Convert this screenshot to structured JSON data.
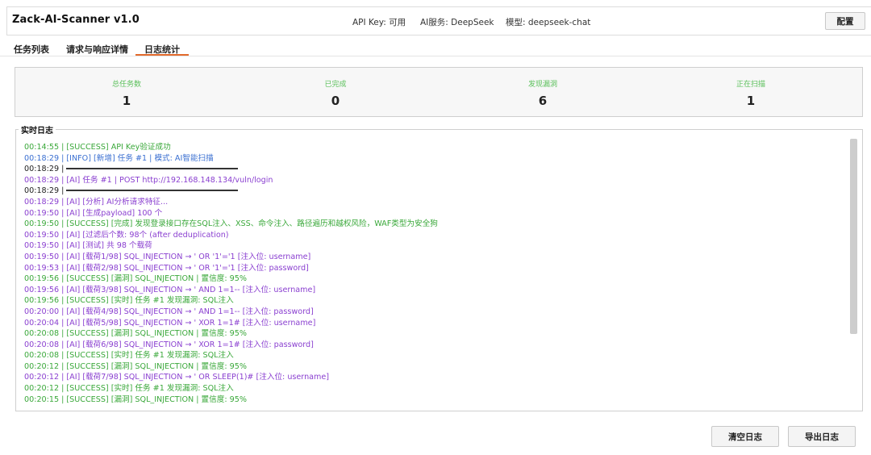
{
  "header": {
    "title": "Zack-AI-Scanner v1.0",
    "api_key_status": "API Key: 可用",
    "ai_service": "AI服务: DeepSeek",
    "model": "模型: deepseek-chat",
    "config_label": "配置"
  },
  "tabs": [
    {
      "label": "任务列表",
      "active": false
    },
    {
      "label": "请求与响应详情",
      "active": false
    },
    {
      "label": "日志统计",
      "active": true
    }
  ],
  "colors": {
    "accent": "#e26a2c",
    "success": "#3aa83a",
    "info": "#3a6fd1",
    "ai": "#8a3fd0"
  },
  "stats": [
    {
      "label": "总任务数",
      "value": "1"
    },
    {
      "label": "已完成",
      "value": "0"
    },
    {
      "label": "发现漏洞",
      "value": "6"
    },
    {
      "label": "正在扫描",
      "value": "1"
    }
  ],
  "log": {
    "title": "实时日志",
    "lines": [
      {
        "text": "00:14:55 | [SUCCESS] API Key验证成功",
        "level": "success"
      },
      {
        "text": "00:18:29 | [INFO] [新增] 任务 #1 | 模式: AI智能扫描",
        "level": "info"
      },
      {
        "text": "00:18:29 | ",
        "level": "separator"
      },
      {
        "text": "00:18:29 | [AI] 任务 #1 | POST http://192.168.148.134/vuln/login",
        "level": "ai"
      },
      {
        "text": "00:18:29 | ",
        "level": "separator"
      },
      {
        "text": "00:18:29 | [AI] [分析] AI分析请求特征...",
        "level": "ai"
      },
      {
        "text": "00:19:50 | [AI] [生成payload] 100 个",
        "level": "ai"
      },
      {
        "text": "00:19:50 | [SUCCESS] [完成] 发现登录接口存在SQL注入、XSS、命令注入、路径遍历和越权风险，WAF类型为安全狗",
        "level": "success"
      },
      {
        "text": "00:19:50 | [AI] [过滤后个数: 98个 (after deduplication)",
        "level": "ai"
      },
      {
        "text": "00:19:50 | [AI] [测试] 共 98 个载荷",
        "level": "ai"
      },
      {
        "text": "00:19:50 | [AI] [载荷1/98] SQL_INJECTION → ' OR '1'='1 [注入位: username]",
        "level": "ai"
      },
      {
        "text": "00:19:53 | [AI] [载荷2/98] SQL_INJECTION → ' OR '1'='1 [注入位: password]",
        "level": "ai"
      },
      {
        "text": "00:19:56 | [SUCCESS] [漏洞] SQL_INJECTION | 置信度: 95%",
        "level": "success"
      },
      {
        "text": "00:19:56 | [AI] [载荷3/98] SQL_INJECTION → ' AND 1=1-- [注入位: username]",
        "level": "ai"
      },
      {
        "text": "00:19:56 | [SUCCESS] [实时] 任务 #1 发现漏洞: SQL注入",
        "level": "success"
      },
      {
        "text": "00:20:00 | [AI] [载荷4/98] SQL_INJECTION → ' AND 1=1-- [注入位: password]",
        "level": "ai"
      },
      {
        "text": "00:20:04 | [AI] [载荷5/98] SQL_INJECTION → ' XOR 1=1# [注入位: username]",
        "level": "ai"
      },
      {
        "text": "00:20:08 | [SUCCESS] [漏洞] SQL_INJECTION | 置信度: 95%",
        "level": "success"
      },
      {
        "text": "00:20:08 | [AI] [载荷6/98] SQL_INJECTION → ' XOR 1=1# [注入位: password]",
        "level": "ai"
      },
      {
        "text": "00:20:08 | [SUCCESS] [实时] 任务 #1 发现漏洞: SQL注入",
        "level": "success"
      },
      {
        "text": "00:20:12 | [SUCCESS] [漏洞] SQL_INJECTION | 置信度: 95%",
        "level": "success"
      },
      {
        "text": "00:20:12 | [AI] [载荷7/98] SQL_INJECTION → ' OR SLEEP(1)# [注入位: username]",
        "level": "ai"
      },
      {
        "text": "00:20:12 | [SUCCESS] [实时] 任务 #1 发现漏洞: SQL注入",
        "level": "success"
      },
      {
        "text": "00:20:15 | [SUCCESS] [漏洞] SQL_INJECTION | 置信度: 95%",
        "level": "success"
      }
    ]
  },
  "buttons": {
    "clear_label": "清空日志",
    "export_label": "导出日志"
  }
}
